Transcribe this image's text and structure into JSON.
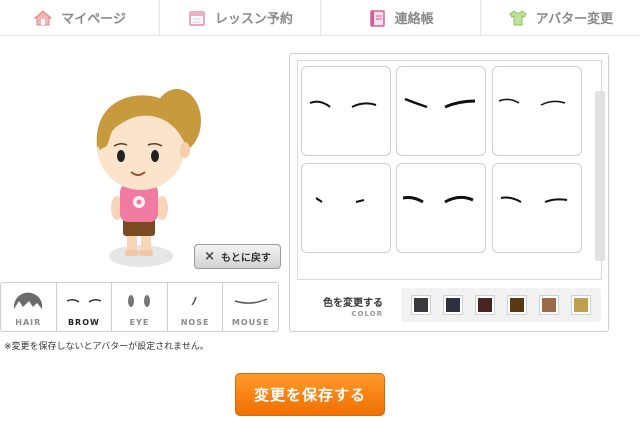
{
  "nav": {
    "items": [
      {
        "label": "マイページ",
        "icon": "house-icon",
        "color": "#f08c8c"
      },
      {
        "label": "レッスン予約",
        "icon": "calendar-icon",
        "color": "#e08aa6"
      },
      {
        "label": "連絡帳",
        "icon": "notebook-icon",
        "color": "#d0609a"
      },
      {
        "label": "アバター変更",
        "icon": "tshirt-icon",
        "color": "#9fcf6a"
      }
    ]
  },
  "avatar": {
    "reset_label": "もとに戻す",
    "hair_color": "#c89a3e",
    "shirt_color": "#f07aa0",
    "shorts_color": "#7b4a22"
  },
  "parts": {
    "active": "BROW",
    "items": [
      {
        "label": "HAIR",
        "icon": "hair-icon"
      },
      {
        "label": "BROW",
        "icon": "brow-icon"
      },
      {
        "label": "EYE",
        "icon": "eye-icon"
      },
      {
        "label": "NOSE",
        "icon": "nose-icon"
      },
      {
        "label": "MOUSE",
        "icon": "mouth-icon"
      }
    ]
  },
  "notice": "※変更を保存しないとアバターが設定されません。",
  "options": {
    "items": [
      "brow-style-1",
      "brow-style-2",
      "brow-style-3",
      "brow-style-4",
      "brow-style-5",
      "brow-style-6"
    ]
  },
  "color": {
    "label": "色を変更する",
    "sublabel": "COLOR",
    "swatches": [
      "#3a3a3c",
      "#2f3040",
      "#4a2420",
      "#5a3a14",
      "#9a6a4a",
      "#c0a050"
    ]
  },
  "save_label": "変更を保存する"
}
